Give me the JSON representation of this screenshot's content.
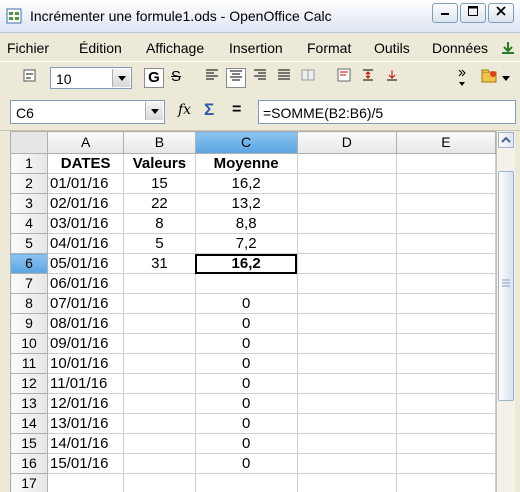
{
  "window": {
    "title": "Incrémenter une formule1.ods - OpenOffice Calc"
  },
  "menu": {
    "items": [
      "Fichier",
      "Édition",
      "Affichage",
      "Insertion",
      "Format",
      "Outils",
      "Données"
    ]
  },
  "toolbar": {
    "font_size": "10",
    "bold_label": "G",
    "strike_label": "S"
  },
  "formula_bar": {
    "name_box": "C6",
    "function_wizard": "fx",
    "sum_symbol": "Σ",
    "equals_symbol": "=",
    "content": "=SOMME(B2:B6)/5"
  },
  "sheet": {
    "columns": [
      "A",
      "B",
      "C",
      "D",
      "E"
    ],
    "selected_column": "C",
    "selected_row": "6",
    "active_cell": "C6",
    "rows": [
      {
        "n": "1",
        "A": "DATES",
        "B": "Valeurs",
        "C": "Moyenne"
      },
      {
        "n": "2",
        "A": "01/01/16",
        "B": "15",
        "C": "16,2"
      },
      {
        "n": "3",
        "A": "02/01/16",
        "B": "22",
        "C": "13,2"
      },
      {
        "n": "4",
        "A": "03/01/16",
        "B": "8",
        "C": "8,8"
      },
      {
        "n": "5",
        "A": "04/01/16",
        "B": "5",
        "C": "7,2"
      },
      {
        "n": "6",
        "A": "05/01/16",
        "B": "31",
        "C": "16,2"
      },
      {
        "n": "7",
        "A": "06/01/16",
        "B": "",
        "C": ""
      },
      {
        "n": "8",
        "A": "07/01/16",
        "B": "",
        "C": "0"
      },
      {
        "n": "9",
        "A": "08/01/16",
        "B": "",
        "C": "0"
      },
      {
        "n": "10",
        "A": "09/01/16",
        "B": "",
        "C": "0"
      },
      {
        "n": "11",
        "A": "10/01/16",
        "B": "",
        "C": "0"
      },
      {
        "n": "12",
        "A": "11/01/16",
        "B": "",
        "C": "0"
      },
      {
        "n": "13",
        "A": "12/01/16",
        "B": "",
        "C": "0"
      },
      {
        "n": "14",
        "A": "13/01/16",
        "B": "",
        "C": "0"
      },
      {
        "n": "15",
        "A": "14/01/16",
        "B": "",
        "C": "0"
      },
      {
        "n": "16",
        "A": "15/01/16",
        "B": "",
        "C": "0"
      },
      {
        "n": "17",
        "A": "",
        "B": "",
        "C": ""
      }
    ]
  },
  "colors": {
    "selection_header": "#5aa4e2",
    "grid_line": "#d0d0d0"
  }
}
